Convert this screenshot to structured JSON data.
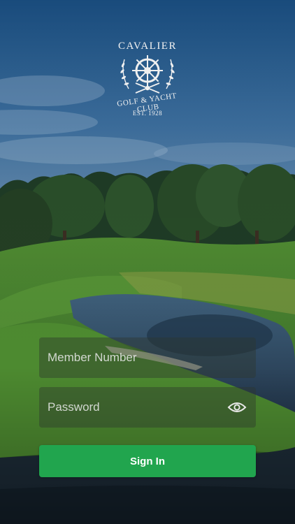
{
  "logo": {
    "title": "CAVALIER",
    "subtitle": "GOLF & YACHT CLUB",
    "established": "EST. 1928"
  },
  "login": {
    "member_number_placeholder": "Member Number",
    "password_placeholder": "Password",
    "sign_in_label": "Sign In",
    "show_password_icon": "eye-icon"
  },
  "colors": {
    "accent": "#21a54e",
    "field_background": "rgba(45,55,45,0.42)",
    "text": "#ffffff"
  }
}
